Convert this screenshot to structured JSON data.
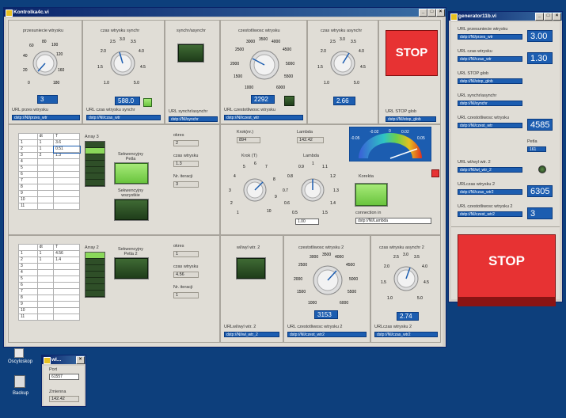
{
  "main": {
    "title": "Kontrolka4c.vi",
    "buttons": {
      "min": "_",
      "max": "□",
      "close": "×"
    },
    "top": {
      "k1": {
        "title": "przesuniecie wtrysku",
        "ticks": [
          "0",
          "20",
          "40",
          "60",
          "80",
          "100",
          "120",
          "140",
          "160",
          "180"
        ],
        "value": "3",
        "url_label": "URL przes wtrysku",
        "url": "dstp://NI/przes_wtr"
      },
      "k2": {
        "title": "czas wtrysku synchr",
        "ticks": [
          "1.0",
          "1.5",
          "2.0",
          "2.5",
          "3.0",
          "3.5",
          "4.0",
          "4.5",
          "5.0"
        ],
        "value": "588.0",
        "url_label": "URL czas wtrysku synchr",
        "url": "dstp://NI/czas_wtr"
      },
      "s": {
        "title": "synchr/asynchr",
        "url_label": "URL synchr/asynchr",
        "url": "dstp://NI/synchr"
      },
      "k3": {
        "title": "czestotliwosc wtrysku",
        "ticks": [
          "1000",
          "1500",
          "2000",
          "2500",
          "3000",
          "3500",
          "4000",
          "4500",
          "5000",
          "5500",
          "6000"
        ],
        "value": "2292",
        "url_label": "URL czestotliwosc wtrysku",
        "url": "dstp://NI/czest_wtr"
      },
      "k4": {
        "title": "czas wtrysku asynchr",
        "ticks": [
          "1.0",
          "1.5",
          "2.0",
          "2.5",
          "3.0",
          "3.5",
          "4.0",
          "4.5",
          "5.0"
        ],
        "value": "2.66"
      },
      "stop": {
        "label": "STOP",
        "url_label": "URL STOP glob",
        "url": "dstp://NI/stop_glob"
      }
    },
    "mid": {
      "table1": {
        "headers": [
          "dt",
          "T"
        ],
        "rows": [
          [
            "1",
            "1",
            "3.6"
          ],
          [
            "2",
            "1",
            "0.51"
          ],
          [
            "3",
            "2",
            "1.3"
          ],
          [
            "4",
            "",
            ""
          ],
          [
            "5",
            "",
            ""
          ],
          [
            "6",
            "",
            ""
          ],
          [
            "7",
            "",
            ""
          ],
          [
            "8",
            "",
            ""
          ],
          [
            "9",
            "",
            ""
          ],
          [
            "10",
            "",
            ""
          ],
          [
            "11",
            "",
            ""
          ]
        ]
      },
      "array_label": "Array 3",
      "sek1": "Sekwencyjny Petla",
      "sek2": "Sekwencyjny wszystkie",
      "okres_label": "okres",
      "okres": "2",
      "czas_label": "czas wtrysku",
      "czas": "1.3",
      "iter_label": "Nr. iteracji",
      "iter": "3",
      "krok_label": "Krok(nr.)",
      "krok": "894",
      "lambda_label": "Lambda",
      "lambda": "142.42",
      "krokT_label": "Krok (T)",
      "krokT_ticks": [
        "1",
        "2",
        "3",
        "4",
        "5",
        "6",
        "7",
        "8",
        "9",
        "10"
      ],
      "lambda2_label": "Lambda",
      "lambda2_ticks": [
        "0.5",
        "0.6",
        "0.7",
        "0.8",
        "0.9",
        "1",
        "1.1",
        "1.2",
        "1.3",
        "1.4",
        "1.5"
      ],
      "lambda2_value": "1.00",
      "gauge_ticks": [
        "-0.05",
        "-0.02",
        "0",
        "0.02",
        "0.05"
      ],
      "korekta_label": "Korekta",
      "conn_label": "connection in",
      "conn": "dstp://NI/Lambda"
    },
    "bot": {
      "table2": {
        "headers": [
          "dt",
          "T"
        ],
        "rows": [
          [
            "1",
            "1",
            "4.56"
          ],
          [
            "2",
            "1",
            "1.4"
          ],
          [
            "3",
            "",
            ""
          ],
          [
            "4",
            "",
            ""
          ],
          [
            "5",
            "",
            ""
          ],
          [
            "6",
            "",
            ""
          ],
          [
            "7",
            "",
            ""
          ],
          [
            "8",
            "",
            ""
          ],
          [
            "9",
            "",
            ""
          ],
          [
            "10",
            "",
            ""
          ],
          [
            "11",
            "",
            ""
          ]
        ]
      },
      "array_label": "Array 2",
      "sek": "Sekwencyjny Petla 2",
      "okres_label": "okres",
      "okres": "1",
      "czas_label": "czas wtrysku",
      "czas": "4.56",
      "iter_label": "Nr. iteracji",
      "iter": "1",
      "wl_title": "wl/wyl wtr. 2",
      "wl_url_label": "URLwl/wyl wtr. 2",
      "wl_url": "dstp://NI/wl_wtr_2",
      "k5": {
        "title": "czestotliwosc wtrysku 2",
        "ticks": [
          "1000",
          "1500",
          "2000",
          "2500",
          "3000",
          "3500",
          "4000",
          "4500",
          "5000",
          "5500",
          "6000"
        ],
        "value": "3153",
        "url_label": "URL czestotliwosc wtrysku 2",
        "url": "dstp://NI/czest_wtr2"
      },
      "k6": {
        "title": "czas wtrysku asynchr 2",
        "ticks": [
          "1.0",
          "1.5",
          "2.0",
          "2.5",
          "3.0",
          "3.5",
          "4.0",
          "4.5",
          "5.0"
        ],
        "value": "2.74",
        "url_label": "URLczas wtrysku 2",
        "url": "dstp://NI/czas_wtr2"
      }
    }
  },
  "gen": {
    "title": "generator11b.vi",
    "rows": [
      {
        "label": "URL przesuniecie wtrysku",
        "url": "dstp://NI/przes_wtr",
        "value": "3.00"
      },
      {
        "label": "URL czas wtrysku",
        "url": "dstp://NI/czas_wtr",
        "value": "1.30"
      },
      {
        "label": "URL STOP glob",
        "url": "dstp://NI/stop_glob",
        "value": ""
      },
      {
        "label": "URL synchr/asynchr",
        "url": "dstp://NI/synchr",
        "value": ""
      },
      {
        "label": "URL czestotliwosc wtrysku",
        "url": "dstp://NI/czest_wtr",
        "value": "4585"
      }
    ],
    "petla_label": "Petla",
    "petla": "161",
    "wl_label": "URL wl/wyl wtr. 2",
    "wl_url": "dstp://NI/wl_wtr_2",
    "czas2_label": "URLczas wtrysku 2",
    "czas2_url": "dstp://NI/czas_wtr2",
    "czas2_value": "6305",
    "czest2_label": "URL czestotliwosc wtrysku 2",
    "czest2_url": "dstp://NI/czest_wtr2",
    "czest2_value": "3",
    "stop": "STOP"
  },
  "desktop": {
    "osc": "Oscyloskop",
    "backup": "Backup"
  },
  "small": {
    "title": "wl...",
    "port_label": "Port",
    "port": "61557",
    "zmienna_label": "Zmienna",
    "zmienna": "142.42"
  },
  "colors": {
    "accent": "#1c5db0",
    "stop": "#e73233",
    "led_dark": "#2f4f28",
    "led_light": "#8ad85a"
  }
}
